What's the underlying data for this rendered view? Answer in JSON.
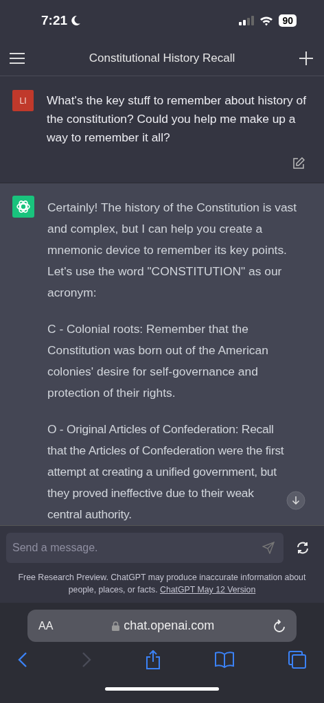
{
  "status_bar": {
    "time": "7:21",
    "battery": "90"
  },
  "header": {
    "title": "Constitutional History Recall"
  },
  "user_message": {
    "avatar": "LI",
    "text": "What's the key stuff to remember about history of the constitution? Could you help me make up a way to remember it all?"
  },
  "assistant_message": {
    "paragraphs": [
      "Certainly! The history of the Constitution is vast and complex, but I can help you create a mnemonic device to remember its key points. Let's use the word \"CONSTITUTION\" as our acronym:",
      "C - Colonial roots: Remember that the Constitution was born out of the American colonies' desire for self-governance and protection of their rights.",
      "O - Original Articles of Confederation: Recall that the Articles of Confederation were the first attempt at creating a unified government, but they proved ineffective due to their weak central authority."
    ]
  },
  "composer": {
    "placeholder": "Send a message."
  },
  "disclaimer": {
    "text": "Free Research Preview. ChatGPT may produce inaccurate information about people, places, or facts.",
    "link": "ChatGPT May 12 Version"
  },
  "browser": {
    "text_size": "AA",
    "url": "chat.openai.com",
    "nav": [
      {
        "kind": "back",
        "disabled": false
      },
      {
        "kind": "forward",
        "disabled": true
      },
      {
        "kind": "share",
        "disabled": false
      },
      {
        "kind": "bookmarks",
        "disabled": false
      },
      {
        "kind": "tabs",
        "disabled": false
      }
    ]
  }
}
